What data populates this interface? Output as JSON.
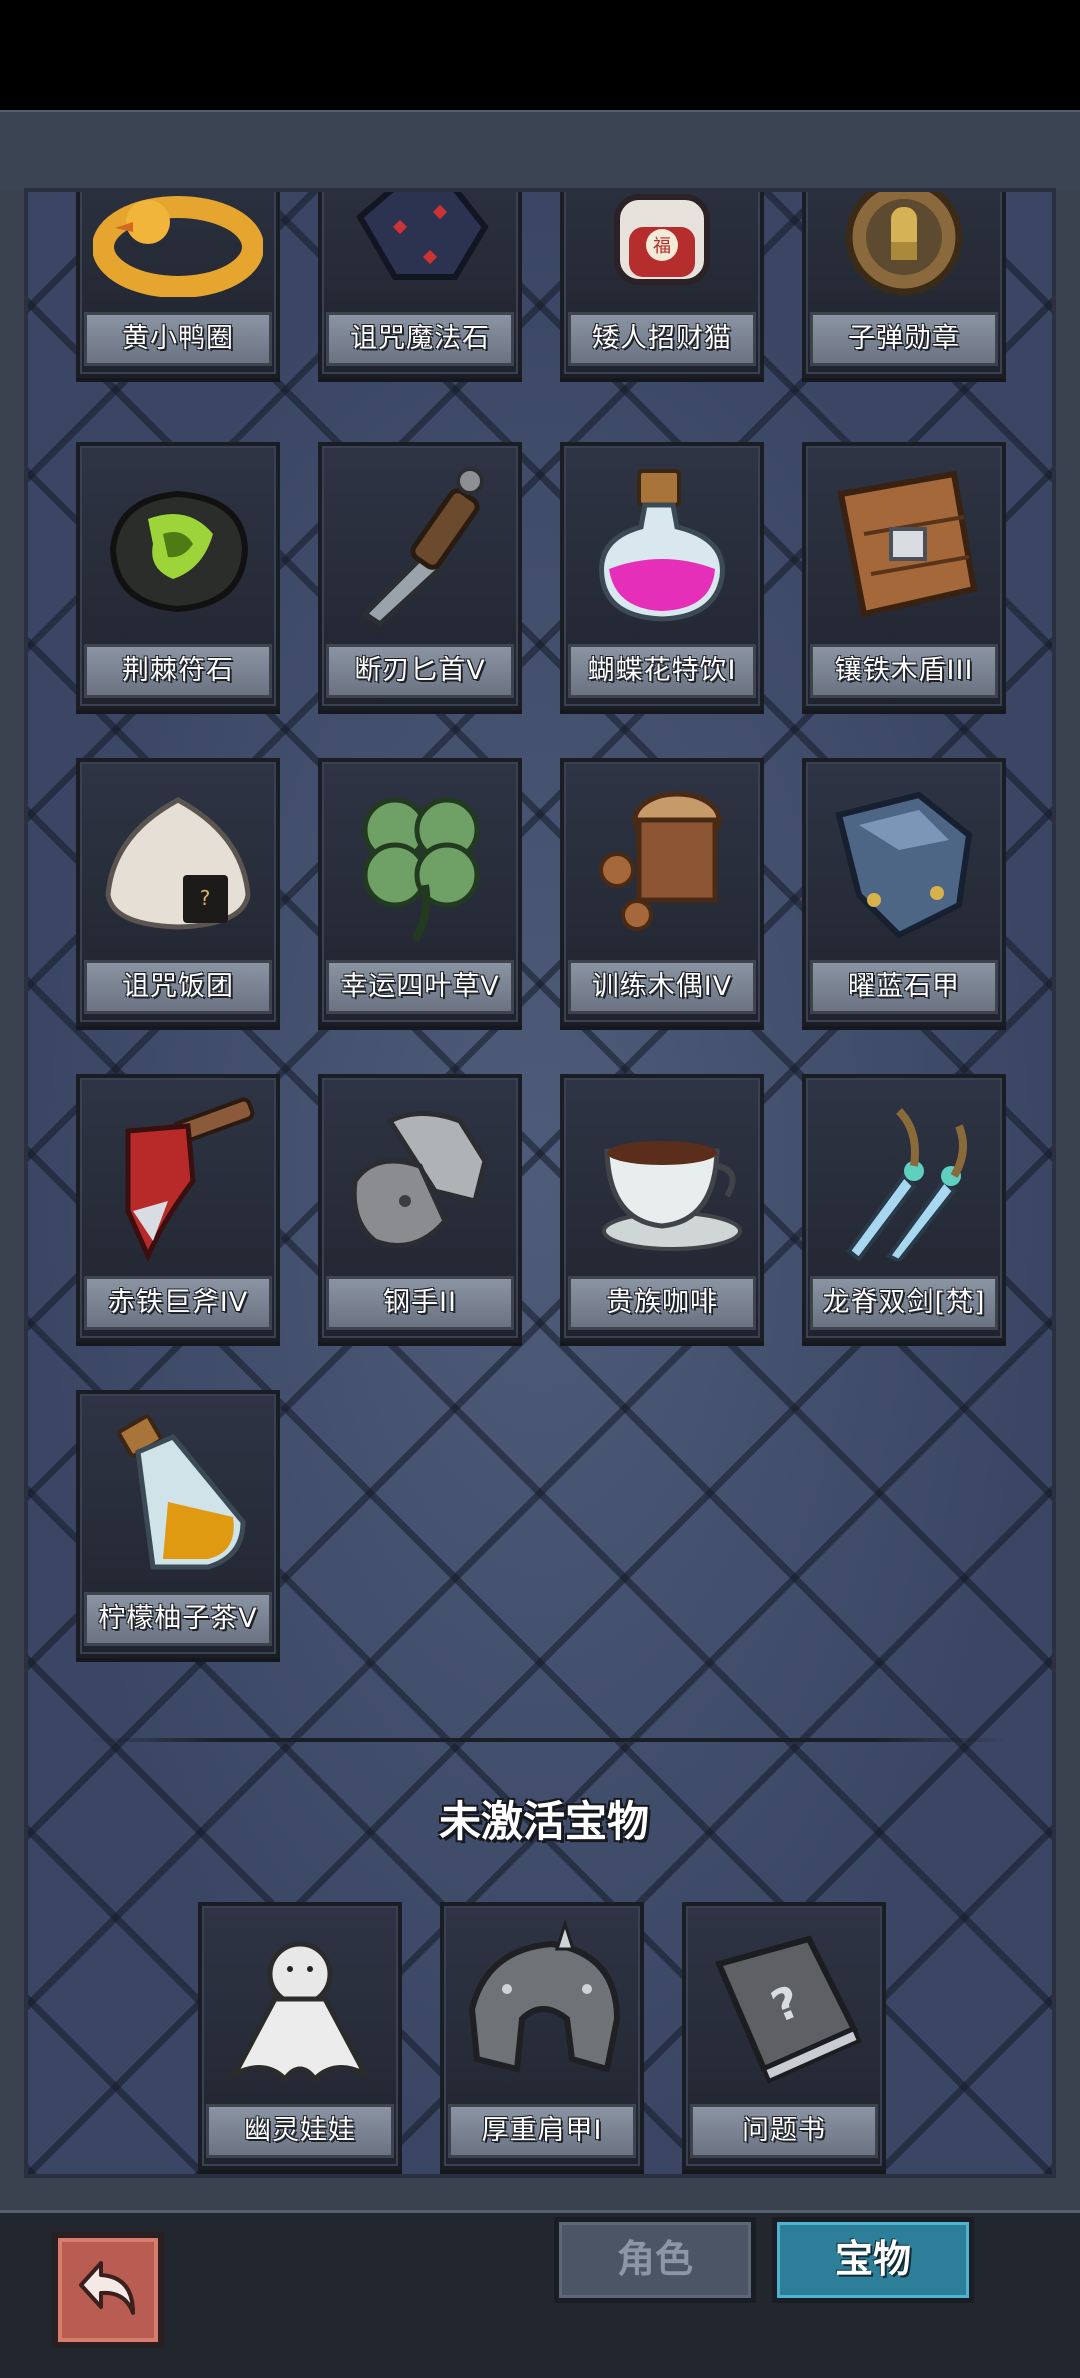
{
  "active_items": [
    {
      "label": "黄小鸭圈",
      "icon": "duck-ring-icon"
    },
    {
      "label": "诅咒魔法石",
      "icon": "cursed-magic-stone-icon"
    },
    {
      "label": "矮人招财猫",
      "icon": "lucky-cat-icon"
    },
    {
      "label": "子弹勋章",
      "icon": "bullet-medal-icon"
    },
    {
      "label": "荆棘符石",
      "icon": "thorn-rune-stone-icon"
    },
    {
      "label": "断刃匕首V",
      "icon": "broken-dagger-icon"
    },
    {
      "label": "蝴蝶花特饮I",
      "icon": "butterfly-potion-icon"
    },
    {
      "label": "镶铁木盾III",
      "icon": "iron-wood-shield-icon"
    },
    {
      "label": "诅咒饭团",
      "icon": "cursed-rice-ball-icon"
    },
    {
      "label": "幸运四叶草V",
      "icon": "four-leaf-clover-icon"
    },
    {
      "label": "训练木偶IV",
      "icon": "training-dummy-icon"
    },
    {
      "label": "曜蓝石甲",
      "icon": "blue-stone-armor-icon"
    },
    {
      "label": "赤铁巨斧IV",
      "icon": "red-iron-axe-icon"
    },
    {
      "label": "钢手II",
      "icon": "steel-gauntlet-icon"
    },
    {
      "label": "贵族咖啡",
      "icon": "coffee-cup-icon"
    },
    {
      "label": "龙脊双剑[梵]",
      "icon": "dragon-twin-swords-icon"
    },
    {
      "label": "柠檬柚子茶V",
      "icon": "lemon-tea-bottle-icon"
    }
  ],
  "inactive_section": {
    "title": "未激活宝物",
    "items": [
      {
        "label": "幽灵娃娃",
        "icon": "ghost-doll-icon"
      },
      {
        "label": "厚重肩甲I",
        "icon": "heavy-shoulder-armor-icon"
      },
      {
        "label": "问题书",
        "icon": "question-book-icon"
      }
    ]
  },
  "tabs": {
    "role": "角色",
    "treasure": "宝物",
    "active": "treasure"
  },
  "back_icon": "back-arrow-icon"
}
